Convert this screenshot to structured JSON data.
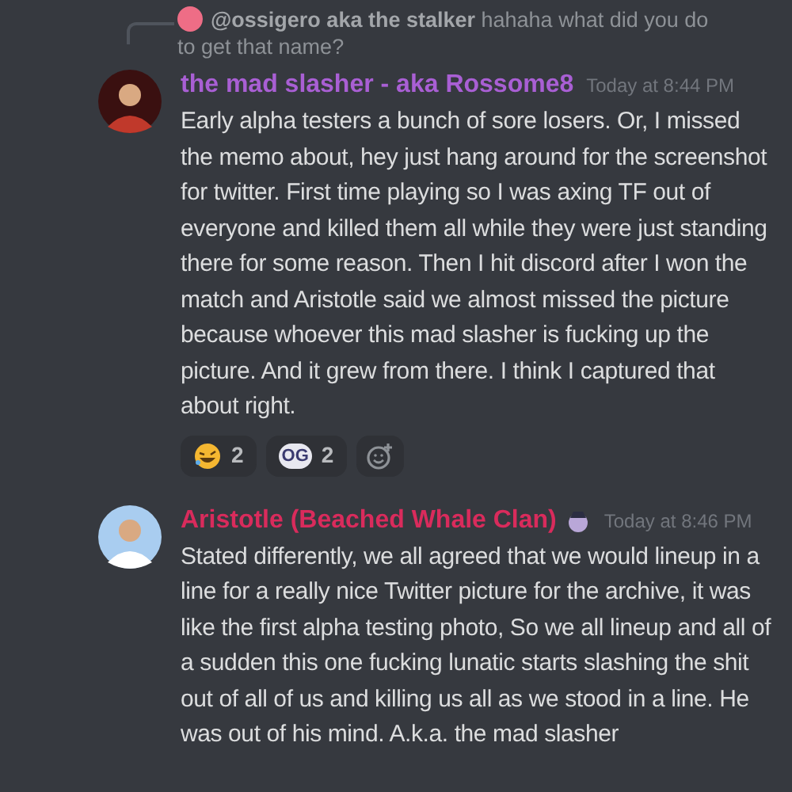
{
  "messages": [
    {
      "reply": {
        "author": "@ossigero aka the stalker",
        "text": "hahaha what did you do to get that name?"
      },
      "author": "the mad slasher - aka Rossome8",
      "color": "#a95fd4",
      "timestamp": "Today at 8:44 PM",
      "badge": false,
      "text": "Early alpha testers a bunch of sore losers. Or, I missed the memo about, hey just hang around for the screenshot for twitter. First time playing so I was axing TF out of everyone and killed them all while they were just standing there for some reason. Then I hit discord after I won the match and Aristotle said we almost missed the picture because whoever this mad slasher is fucking up the picture. And it grew from there. I think I captured that about right.",
      "reactions": [
        {
          "kind": "laugh",
          "count": "2"
        },
        {
          "kind": "text",
          "emoji": "OG",
          "count": "2"
        },
        {
          "kind": "add"
        }
      ]
    },
    {
      "author": "Aristotle (Beached Whale Clan)",
      "color": "#d92b5c",
      "timestamp": "Today at 8:46 PM",
      "badge": true,
      "text": "Stated differently, we all agreed that we would lineup in a line for a really nice Twitter picture for the archive, it was like the first alpha testing photo, So we all lineup and all of a sudden this one fucking lunatic starts slashing the shit out of all of us and killing us all as we stood in a line. He was out of his mind. A.k.a. the mad slasher"
    }
  ]
}
